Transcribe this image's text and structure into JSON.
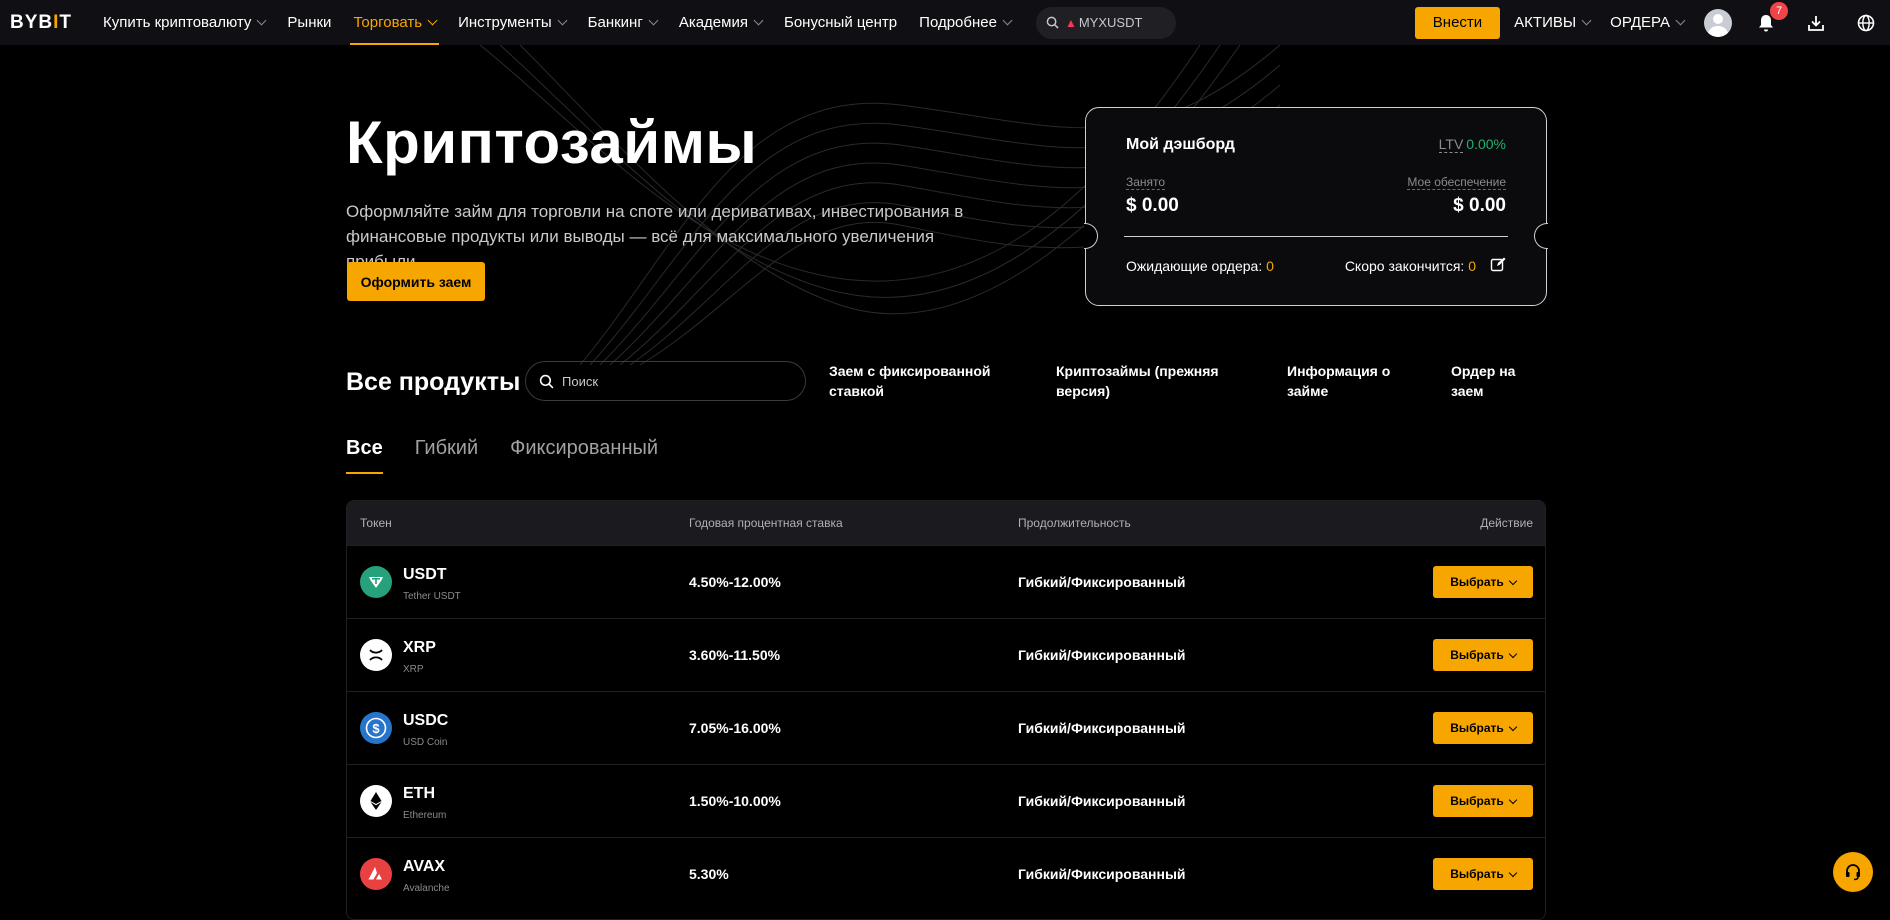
{
  "nav": {
    "logo": "BYBIT",
    "items": [
      {
        "label": "Купить криптовалюту",
        "chevron": true
      },
      {
        "label": "Рынки",
        "chevron": false
      },
      {
        "label": "Торговать",
        "chevron": true,
        "active": true
      },
      {
        "label": "Инструменты",
        "chevron": true
      },
      {
        "label": "Банкинг",
        "chevron": true
      },
      {
        "label": "Академия",
        "chevron": true
      },
      {
        "label": "Бонусный центр",
        "chevron": false
      },
      {
        "label": "Подробнее",
        "chevron": true
      }
    ],
    "search_text": "MYXUSDT",
    "deposit_label": "Внести",
    "assets_label": "АКТИВЫ",
    "orders_label": "ОРДЕРА",
    "notification_count": "7",
    "accent_color": "#f7a600"
  },
  "hero": {
    "title": "Криптозаймы",
    "description": "Оформляйте займ для торговли на споте или деривативах, инвестирования в финансовые продукты или выводы — всё для максимального увеличения прибыли.",
    "button_label": "Оформить заем"
  },
  "dashboard": {
    "title": "Мой дэшборд",
    "ltv_label": "LTV",
    "ltv_value": "0.00%",
    "borrowed_label": "Занято",
    "borrowed_value": "$ 0.00",
    "collateral_label": "Мое обеспечение",
    "collateral_value": "$ 0.00",
    "pending_label": "Ожидающие ордера:",
    "pending_value": "0",
    "expiring_label": "Скоро закончится:",
    "expiring_value": "0"
  },
  "products": {
    "title": "Все продукты",
    "search_placeholder": "Поиск",
    "links": [
      "Заем с фиксированной ставкой",
      "Криптозаймы (прежняя версия)",
      "Информация о займе",
      "Ордер на заем"
    ],
    "tabs": [
      "Все",
      "Гибкий",
      "Фиксированный"
    ],
    "columns": {
      "token": "Токен",
      "rate": "Годовая процентная ставка",
      "duration": "Продолжительность",
      "action": "Действие"
    },
    "rows": [
      {
        "symbol": "USDT",
        "name": "Tether USDT",
        "rate": "4.50%-12.00%",
        "duration": "Гибкий/Фиксированный",
        "action": "Выбрать",
        "icon": "tether-icon",
        "color": "#26a17b"
      },
      {
        "symbol": "XRP",
        "name": "XRP",
        "rate": "3.60%-11.50%",
        "duration": "Гибкий/Фиксированный",
        "action": "Выбрать",
        "icon": "xrp-icon",
        "color": "#ffffff"
      },
      {
        "symbol": "USDC",
        "name": "USD Coin",
        "rate": "7.05%-16.00%",
        "duration": "Гибкий/Фиксированный",
        "action": "Выбрать",
        "icon": "usdc-icon",
        "color": "#2775ca"
      },
      {
        "symbol": "ETH",
        "name": "Ethereum",
        "rate": "1.50%-10.00%",
        "duration": "Гибкий/Фиксированный",
        "action": "Выбрать",
        "icon": "ethereum-icon",
        "color": "#ffffff"
      },
      {
        "symbol": "AVAX",
        "name": "Avalanche",
        "rate": "5.30%",
        "duration": "Гибкий/Фиксированный",
        "action": "Выбрать",
        "icon": "avalanche-icon",
        "color": "#e84142"
      }
    ]
  }
}
